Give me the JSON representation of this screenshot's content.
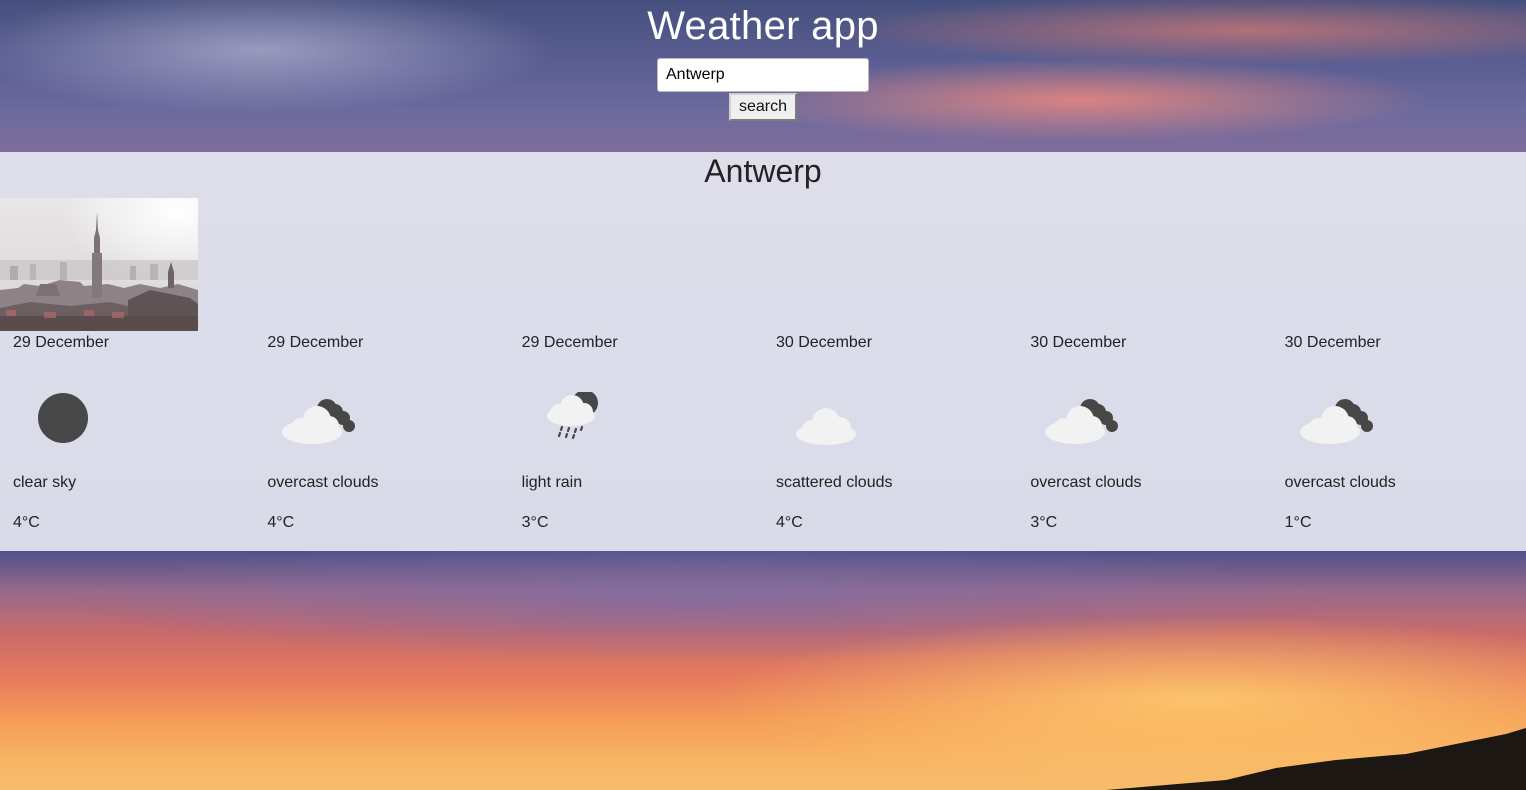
{
  "header": {
    "title": "Weather app",
    "search_value": "Antwerp",
    "search_button_label": "search"
  },
  "result": {
    "city": "Antwerp",
    "photo_alt": "Antwerp skyline"
  },
  "forecast": [
    {
      "date": "29 December",
      "icon": "clear-sky-icon",
      "description": "clear sky",
      "temperature": "4°C"
    },
    {
      "date": "29 December",
      "icon": "overcast-clouds-icon",
      "description": "overcast clouds",
      "temperature": "4°C"
    },
    {
      "date": "29 December",
      "icon": "light-rain-icon",
      "description": "light rain",
      "temperature": "3°C"
    },
    {
      "date": "30 December",
      "icon": "scattered-clouds-icon",
      "description": "scattered clouds",
      "temperature": "4°C"
    },
    {
      "date": "30 December",
      "icon": "overcast-clouds-icon",
      "description": "overcast clouds",
      "temperature": "3°C"
    },
    {
      "date": "30 December",
      "icon": "overcast-clouds-icon",
      "description": "overcast clouds",
      "temperature": "1°C"
    }
  ],
  "colors": {
    "icon_dark": "#474747",
    "icon_light": "#f2f2f2",
    "text": "#222222"
  }
}
